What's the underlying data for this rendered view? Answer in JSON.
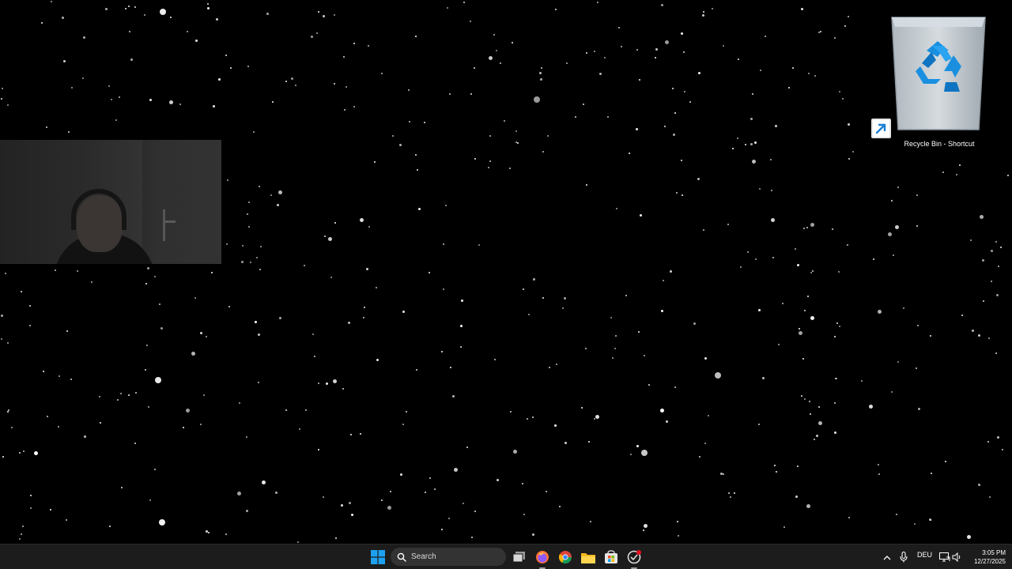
{
  "desktop": {
    "icons": [
      {
        "label": "Recycle Bin - Shortcut",
        "icon": "recycle-bin-icon"
      }
    ]
  },
  "webcam": {
    "description_icon": "webcam-overlay"
  },
  "taskbar": {
    "start_icon": "windows-start-icon",
    "search_placeholder": "Search",
    "pinned": [
      {
        "name": "task-view-icon"
      },
      {
        "name": "firefox-icon"
      },
      {
        "name": "chrome-icon"
      },
      {
        "name": "file-explorer-icon"
      },
      {
        "name": "microsoft-store-icon"
      },
      {
        "name": "app-icon"
      }
    ],
    "tray": {
      "language": "DEU",
      "time": "3:05 PM",
      "date": "12/27/2025"
    }
  },
  "colors": {
    "desktop_bg": "#000000",
    "taskbar_bg": "#1c1c1c",
    "accent_blue": "#0a84d8"
  }
}
